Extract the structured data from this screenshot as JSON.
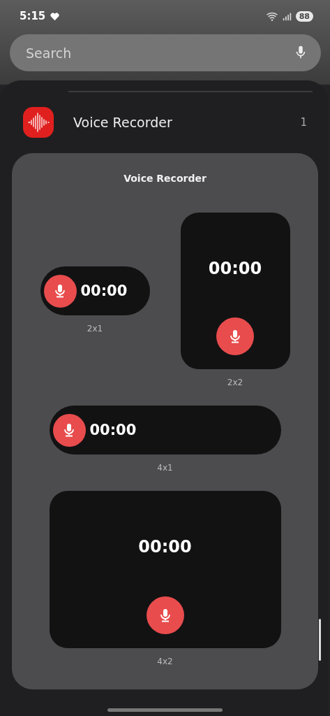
{
  "status_bar": {
    "time": "5:15",
    "battery": "88"
  },
  "search": {
    "placeholder": "Search"
  },
  "app_row": {
    "name": "Voice Recorder",
    "count": "1"
  },
  "widget_panel": {
    "title": "Voice Recorder",
    "rows": [
      [
        {
          "kind": "pill",
          "wide": false,
          "time": "00:00",
          "size": "2x1"
        },
        {
          "kind": "tile",
          "wide": false,
          "time": "00:00",
          "size": "2x2"
        }
      ],
      [
        {
          "kind": "pill",
          "wide": true,
          "time": "00:00",
          "size": "4x1"
        }
      ],
      [
        {
          "kind": "tile",
          "wide": true,
          "time": "00:00",
          "size": "4x2"
        }
      ]
    ]
  }
}
